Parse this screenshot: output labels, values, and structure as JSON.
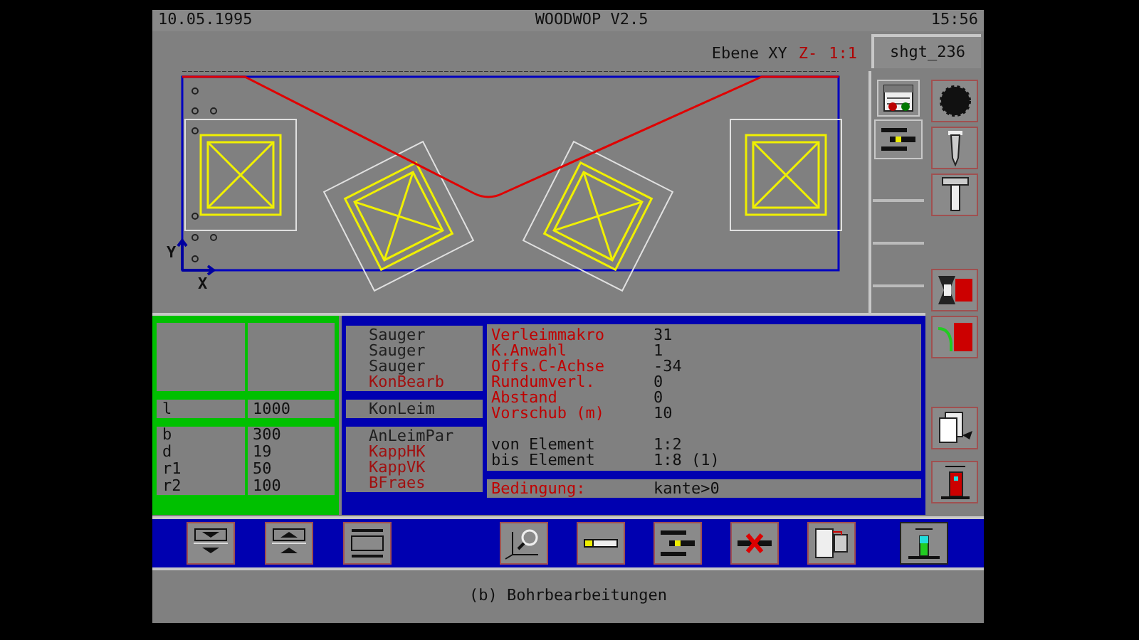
{
  "header": {
    "date": "10.05.1995",
    "title": "WOODWOP V2.5",
    "time": "15:56"
  },
  "view": {
    "plane": "Ebene XY",
    "direction": "Z-",
    "scale": "1:1"
  },
  "file_name": "shgt_236",
  "axis_labels": {
    "y": "Y",
    "x": "X"
  },
  "dimensions": {
    "length": {
      "label": "l",
      "value": "1000"
    },
    "rows": [
      {
        "label": "b",
        "value": "300"
      },
      {
        "label": "d",
        "value": "19"
      },
      {
        "label": "r1",
        "value": "50"
      },
      {
        "label": "r2",
        "value": "100"
      }
    ]
  },
  "macro_groups": [
    [
      {
        "label": "Sauger",
        "color": "#202020"
      },
      {
        "label": "Sauger",
        "color": "#202020"
      },
      {
        "label": "Sauger",
        "color": "#202020"
      },
      {
        "label": "KonBearb",
        "color": "#a01010"
      }
    ],
    [
      {
        "label": "KonLeim",
        "color": "#202020"
      }
    ],
    [
      {
        "label": "AnLeimPar",
        "color": "#202020"
      },
      {
        "label": "KappHK",
        "color": "#a01010"
      },
      {
        "label": "KappVK",
        "color": "#a01010"
      },
      {
        "label": "BFraes",
        "color": "#a01010"
      }
    ]
  ],
  "parameters": [
    {
      "kind": "param",
      "label": "Verleimmakro",
      "value": "31"
    },
    {
      "kind": "param",
      "label": "K.Anwahl",
      "value": "1"
    },
    {
      "kind": "param",
      "label": "Offs.C-Achse",
      "value": "-34"
    },
    {
      "kind": "param",
      "label": "Rundumverl.",
      "value": "0"
    },
    {
      "kind": "param",
      "label": "Abstand",
      "value": "0"
    },
    {
      "kind": "param",
      "label": "Vorschub (m)",
      "value": "10"
    },
    {
      "kind": "range",
      "label": "von Element",
      "value": "1:2"
    },
    {
      "kind": "range",
      "label": "bis Element",
      "value": "1:8 (1)"
    }
  ],
  "condition": {
    "label": "Bedingung:",
    "value": "kante>0"
  },
  "status": "(b) Bohrbearbeitungen"
}
